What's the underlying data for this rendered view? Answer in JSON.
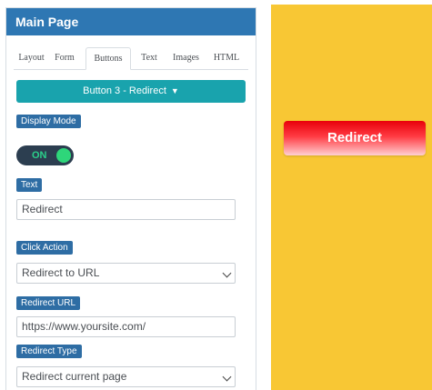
{
  "panel": {
    "title": "Main Page"
  },
  "tabs": [
    {
      "label": "Layout"
    },
    {
      "label": "Form"
    },
    {
      "label": "Buttons"
    },
    {
      "label": "Text"
    },
    {
      "label": "Images"
    },
    {
      "label": "HTML"
    }
  ],
  "active_tab": "Buttons",
  "button_selector": {
    "label": "Button 3 - Redirect",
    "caret": "▼"
  },
  "display_mode": {
    "label": "Display Mode",
    "state": "ON"
  },
  "text_field": {
    "label": "Text",
    "value": "Redirect"
  },
  "click_action": {
    "label": "Click Action",
    "value": "Redirect to URL"
  },
  "redirect_url": {
    "label": "Redirect URL",
    "value": "https://www.yoursite.com/"
  },
  "redirect_type": {
    "label": "Redirect Type",
    "value": "Redirect current page"
  },
  "preview": {
    "button_label": "Redirect"
  },
  "colors": {
    "header": "#2e77b3",
    "dropdown": "#19a3ad",
    "badge": "#2e6da4",
    "preview_bg": "#f8c734",
    "preview_button": "#e8000a"
  }
}
